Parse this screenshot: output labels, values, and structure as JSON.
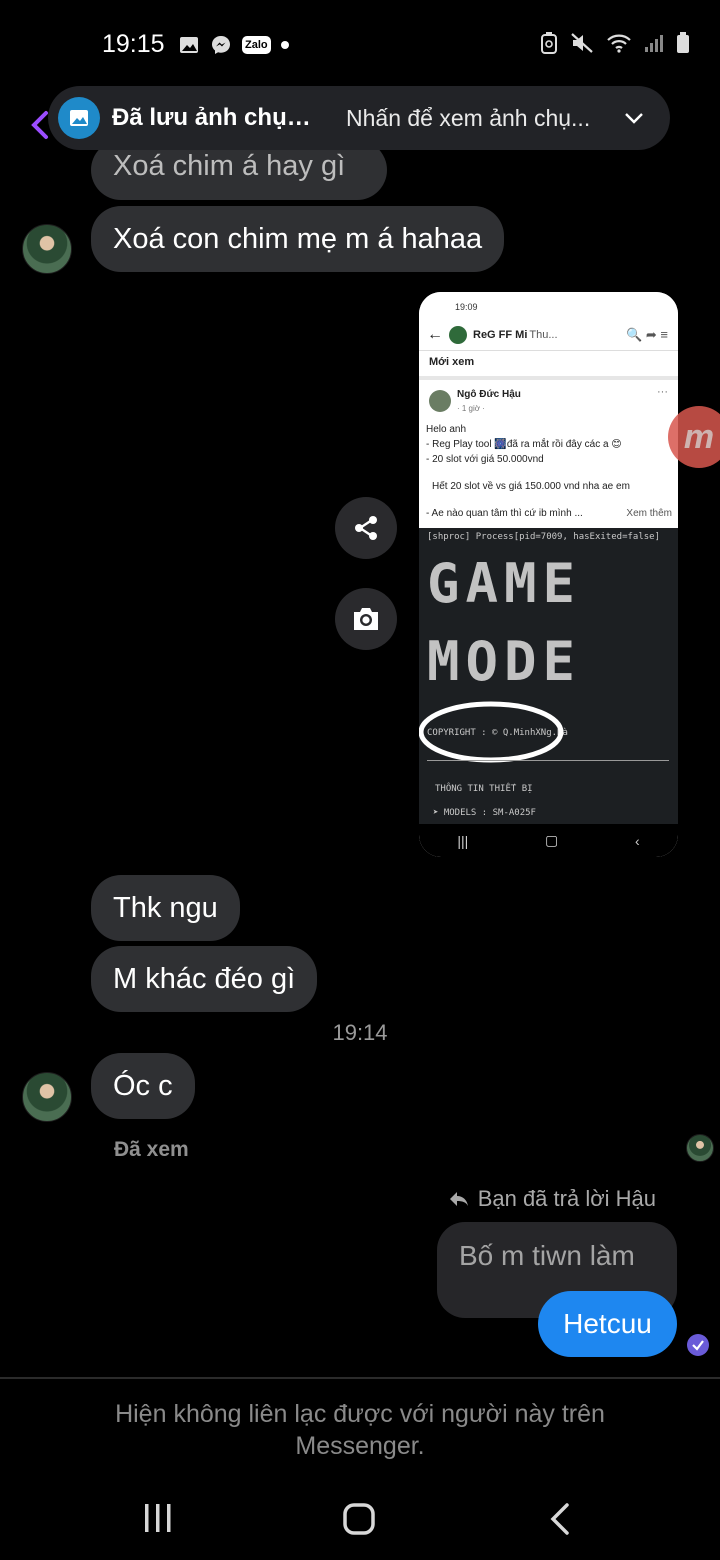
{
  "status_bar": {
    "time": "19:15",
    "icons": [
      "image-icon",
      "messenger-icon",
      "zalo-icon",
      "dot-icon",
      "battery-saver-icon",
      "mute-icon",
      "wifi-icon",
      "signal-icon",
      "battery-icon"
    ],
    "zalo_label": "Zalo"
  },
  "toast": {
    "title": "Đã lưu ảnh chụp...",
    "subtitle": "Nhấn để xem ảnh chụ..."
  },
  "messages": {
    "partial_text": "Xoá chim á hay gì",
    "m1": "Xoá con chim mẹ m á hahaa",
    "m2": "Thk ngu",
    "m3": "M khác đéo gì",
    "time_sep": "19:14",
    "m4": "Óc c",
    "seen": "Đã xem",
    "reply_note": "Bạn đã trả lời Hậu",
    "reply_quote": "Bố m tiwn làm",
    "out_msg": "Hetcuu"
  },
  "shared_image": {
    "status_time": "19:09",
    "page_name": "ReG FF Mi",
    "page_name_tail": "Thu...",
    "section": "Mới xem",
    "author": "Ngô Đức Hậu",
    "meta": "· 1 giờ ·",
    "post_lines": [
      "Helo anh",
      "- Reg Play tool 🎆đã ra mắt rồi đây các a 😊",
      "- 20 slot với giá 50.000vnd",
      "Hết 20 slot về vs giá 150.000 vnd nha ae em",
      "- Ae nào quan tâm thì cứ ib mình ..."
    ],
    "see_more": "Xem thêm",
    "term_line": "[shproc] Process[pid=7009, hasExited=false]",
    "ascii_1": "GAME",
    "ascii_2": "MODE",
    "copyright": "COPYRIGHT : © Q.MinhXNg.Hà",
    "info_header": "THÔNG TIN THIẾT BỊ",
    "models": "➤ MODELS : SM-A025F"
  },
  "reaction_letter": "m",
  "footer": {
    "note": "Hiện không liên lạc được với người này trên Messenger."
  },
  "colors": {
    "bubble_in": "#2f3033",
    "bubble_out": "#1e87f0",
    "toast_icon": "#1f8ac9",
    "read_check": "#6a5bd8"
  }
}
